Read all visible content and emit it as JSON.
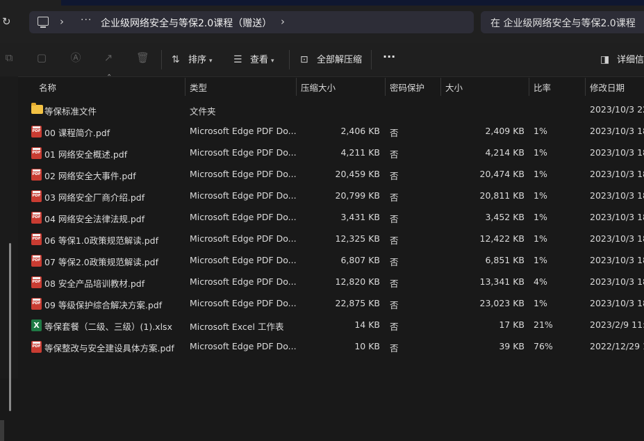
{
  "address": {
    "crumb": "企业级网络安全与等保2.0课程（赠送）",
    "dots": "···",
    "chevron": "›"
  },
  "search": {
    "placeholder": "在 企业级网络安全与等保2.0课程"
  },
  "toolbar": {
    "sort_label": "排序",
    "view_label": "查看",
    "extract_label": "全部解压缩",
    "more_label": "···",
    "details_label": "详细信"
  },
  "columns": {
    "name": "名称",
    "type": "类型",
    "compressed": "压缩大小",
    "password": "密码保护",
    "size": "大小",
    "ratio": "比率",
    "modified": "修改日期"
  },
  "files": [
    {
      "icon": "folder-icon",
      "name": "等保标准文件",
      "type": "文件夹",
      "compressed": "",
      "password": "",
      "size": "",
      "ratio": "",
      "modified": "2023/10/3 22"
    },
    {
      "icon": "pdf-icon",
      "name": "00 课程简介.pdf",
      "type": "Microsoft Edge PDF Do...",
      "compressed": "2,406 KB",
      "password": "否",
      "size": "2,409 KB",
      "ratio": "1%",
      "modified": "2023/10/3 18"
    },
    {
      "icon": "pdf-icon",
      "name": "01 网络安全概述.pdf",
      "type": "Microsoft Edge PDF Do...",
      "compressed": "4,211 KB",
      "password": "否",
      "size": "4,214 KB",
      "ratio": "1%",
      "modified": "2023/10/3 18"
    },
    {
      "icon": "pdf-icon",
      "name": "02 网络安全大事件.pdf",
      "type": "Microsoft Edge PDF Do...",
      "compressed": "20,459 KB",
      "password": "否",
      "size": "20,474 KB",
      "ratio": "1%",
      "modified": "2023/10/3 18"
    },
    {
      "icon": "pdf-icon",
      "name": "03 网络安全厂商介绍.pdf",
      "type": "Microsoft Edge PDF Do...",
      "compressed": "20,799 KB",
      "password": "否",
      "size": "20,811 KB",
      "ratio": "1%",
      "modified": "2023/10/3 18"
    },
    {
      "icon": "pdf-icon",
      "name": "04 网络安全法律法规.pdf",
      "type": "Microsoft Edge PDF Do...",
      "compressed": "3,431 KB",
      "password": "否",
      "size": "3,452 KB",
      "ratio": "1%",
      "modified": "2023/10/3 18"
    },
    {
      "icon": "pdf-icon",
      "name": "06 等保1.0政策规范解读.pdf",
      "type": "Microsoft Edge PDF Do...",
      "compressed": "12,325 KB",
      "password": "否",
      "size": "12,422 KB",
      "ratio": "1%",
      "modified": "2023/10/3 18"
    },
    {
      "icon": "pdf-icon",
      "name": "07 等保2.0政策规范解读.pdf",
      "type": "Microsoft Edge PDF Do...",
      "compressed": "6,807 KB",
      "password": "否",
      "size": "6,851 KB",
      "ratio": "1%",
      "modified": "2023/10/3 18"
    },
    {
      "icon": "pdf-icon",
      "name": "08 安全产品培训教材.pdf",
      "type": "Microsoft Edge PDF Do...",
      "compressed": "12,820 KB",
      "password": "否",
      "size": "13,341 KB",
      "ratio": "4%",
      "modified": "2023/10/3 18"
    },
    {
      "icon": "pdf-icon",
      "name": "09 等级保护综合解决方案.pdf",
      "type": "Microsoft Edge PDF Do...",
      "compressed": "22,875 KB",
      "password": "否",
      "size": "23,023 KB",
      "ratio": "1%",
      "modified": "2023/10/3 18"
    },
    {
      "icon": "excel-icon",
      "name": "等保套餐（二级、三级）(1).xlsx",
      "type": "Microsoft Excel 工作表",
      "compressed": "14 KB",
      "password": "否",
      "size": "17 KB",
      "ratio": "21%",
      "modified": "2023/2/9 11:0"
    },
    {
      "icon": "pdf-icon",
      "name": "等保整改与安全建设具体方案.pdf",
      "type": "Microsoft Edge PDF Do...",
      "compressed": "10 KB",
      "password": "否",
      "size": "39 KB",
      "ratio": "76%",
      "modified": "2022/12/29 1"
    }
  ]
}
